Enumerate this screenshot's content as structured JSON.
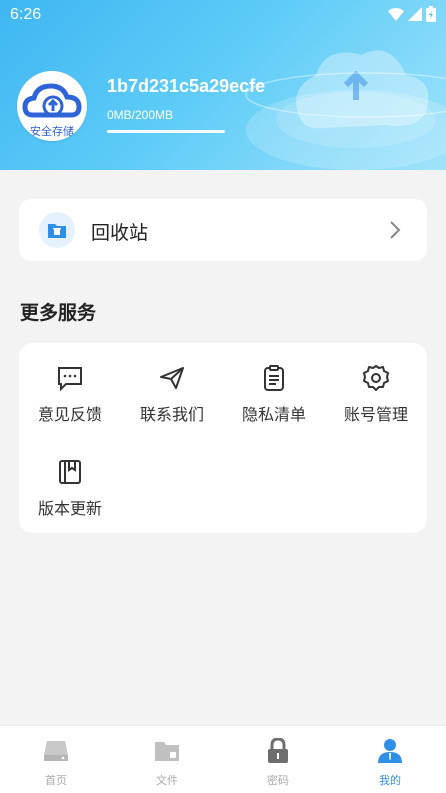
{
  "status": {
    "time": "6:26"
  },
  "profile": {
    "user_id": "1b7d231c5a29ecfe",
    "storage": "0MB/200MB",
    "avatar_text": "安全存储"
  },
  "recycle": {
    "label": "回收站"
  },
  "services": {
    "title": "更多服务",
    "items": [
      {
        "label": "意见反馈",
        "icon": "feedback-icon"
      },
      {
        "label": "联系我们",
        "icon": "send-icon"
      },
      {
        "label": "隐私清单",
        "icon": "clipboard-icon"
      },
      {
        "label": "账号管理",
        "icon": "gear-icon"
      },
      {
        "label": "版本更新",
        "icon": "book-icon"
      }
    ]
  },
  "nav": {
    "items": [
      {
        "label": "首页",
        "icon": "drive-icon"
      },
      {
        "label": "文件",
        "icon": "folder-icon"
      },
      {
        "label": "密码",
        "icon": "lock-icon"
      },
      {
        "label": "我的",
        "icon": "user-icon"
      }
    ],
    "active": "我的"
  },
  "colors": {
    "accent": "#2f8fe8",
    "header_start": "#3fb6f2",
    "header_end": "#9fe3fb"
  }
}
